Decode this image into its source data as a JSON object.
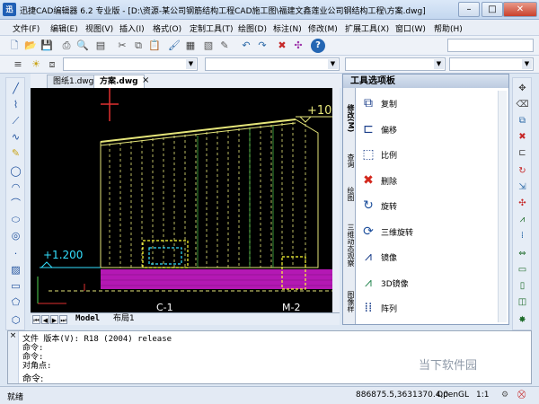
{
  "window": {
    "app_icon_text": "迅",
    "title": "迅捷CAD编辑器 6.2 专业版 - [D:\\资源-某公司钢筋结构工程CAD施工图\\福建文鑫莲业公司钢结构工程\\方案.dwg]",
    "minimize": "–",
    "maximize": "□",
    "close": "✕"
  },
  "menu": [
    "文件(F)",
    "编辑(E)",
    "视图(V)",
    "插入(I)",
    "格式(O)",
    "定制工具(T)",
    "绘图(D)",
    "标注(N)",
    "修改(M)",
    "扩展工具(X)",
    "窗口(W)",
    "帮助(H)"
  ],
  "toolbar1_icons": [
    "new-file-icon",
    "open-folder-icon",
    "save-icon",
    "print-icon",
    "print-preview-icon",
    "cut-icon",
    "copy-icon",
    "paste-icon",
    "match-properties-icon",
    "undo-icon",
    "redo-icon",
    "delete-icon",
    "erase-icon",
    "help-icon"
  ],
  "doc_tabs": [
    "图纸1.dwg",
    "方案.dwg"
  ],
  "sheet_tabs": [
    "Model",
    "布局1"
  ],
  "drawing": {
    "elev_top": "+10.",
    "elev_left": "+1.200",
    "label_c1": "C-1",
    "label_m2": "M-2"
  },
  "palette": {
    "title": "工具选项板",
    "side_tabs": [
      "修改(M)",
      "查询",
      "绘图",
      "三维动态观察",
      "图像样"
    ],
    "tools": [
      {
        "label": "复制",
        "icon": "copy-tool-icon",
        "glyph": "⧉",
        "color": "#1b3f8a"
      },
      {
        "label": "偏移",
        "icon": "offset-tool-icon",
        "glyph": "⊏",
        "color": "#1b3f8a"
      },
      {
        "label": "比例",
        "icon": "scale-tool-icon",
        "glyph": "⬚",
        "color": "#1b3f8a"
      },
      {
        "label": "删除",
        "icon": "delete-tool-icon",
        "glyph": "✖",
        "color": "#d3271c"
      },
      {
        "label": "旋转",
        "icon": "rotate-tool-icon",
        "glyph": "↻",
        "color": "#1d4f9c"
      },
      {
        "label": "三维旋转",
        "icon": "rotate3d-tool-icon",
        "glyph": "⟳",
        "color": "#1d4f9c"
      },
      {
        "label": "镜像",
        "icon": "mirror-tool-icon",
        "glyph": "⩘",
        "color": "#1b3f8a"
      },
      {
        "label": "3D镜像",
        "icon": "mirror3d-tool-icon",
        "glyph": "⩘",
        "color": "#2e8b57"
      },
      {
        "label": "阵列",
        "icon": "array-tool-icon",
        "glyph": "⁞⁞",
        "color": "#1b3f8a"
      }
    ]
  },
  "command": {
    "lines": [
      "文件 版本(V): R18 (2004) release",
      "命令:",
      "命令:",
      "对角点:"
    ],
    "prompt": "命令:"
  },
  "status": {
    "ready": "就绪",
    "coords": "886875.5,3631370.4,0",
    "renderer": "OpenGL",
    "scale": "1:1"
  },
  "watermark": "当下软件园"
}
